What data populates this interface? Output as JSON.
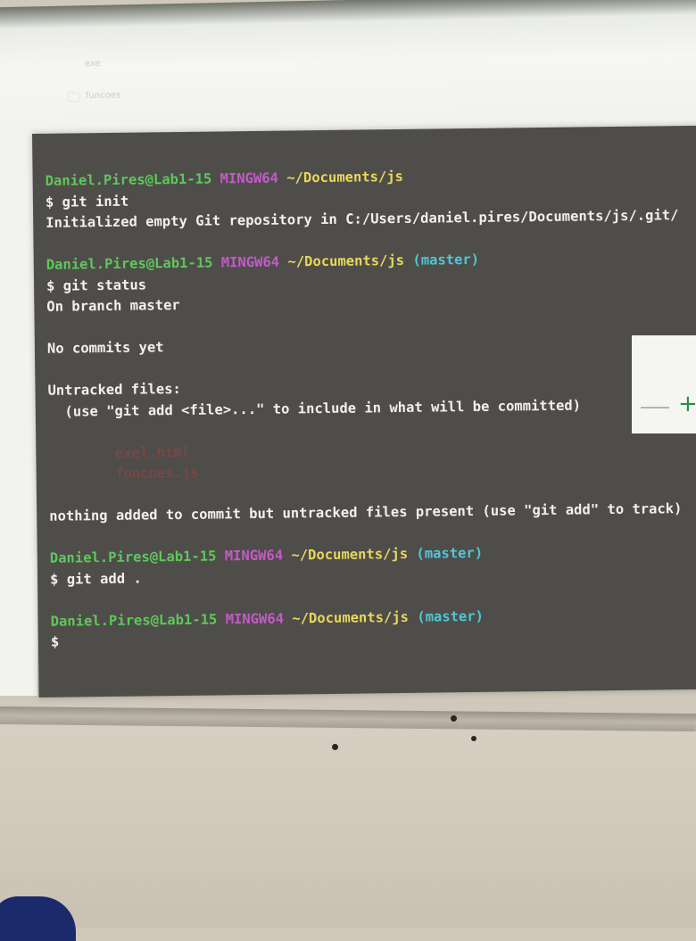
{
  "terminal": {
    "lines": [
      {
        "type": "prompt",
        "user": "Daniel.Pires@Lab1-15",
        "env": "MINGW64",
        "path": "~/Documents/js",
        "branch": ""
      },
      {
        "type": "cmd",
        "text": "$ git init"
      },
      {
        "type": "out",
        "text": "Initialized empty Git repository in C:/Users/daniel.pires/Documents/js/.git/"
      },
      {
        "type": "blank"
      },
      {
        "type": "prompt",
        "user": "Daniel.Pires@Lab1-15",
        "env": "MINGW64",
        "path": "~/Documents/js",
        "branch": "(master)"
      },
      {
        "type": "cmd",
        "text": "$ git status"
      },
      {
        "type": "out",
        "text": "On branch master"
      },
      {
        "type": "blank"
      },
      {
        "type": "out",
        "text": "No commits yet"
      },
      {
        "type": "blank"
      },
      {
        "type": "out",
        "text": "Untracked files:"
      },
      {
        "type": "out",
        "text": "  (use \"git add <file>...\" to include in what will be committed)"
      },
      {
        "type": "blank"
      },
      {
        "type": "untracked",
        "text": "        exel.html"
      },
      {
        "type": "untracked",
        "text": "        funcoes.js"
      },
      {
        "type": "blank"
      },
      {
        "type": "out",
        "text": "nothing added to commit but untracked files present (use \"git add\" to track)"
      },
      {
        "type": "blank"
      },
      {
        "type": "prompt",
        "user": "Daniel.Pires@Lab1-15",
        "env": "MINGW64",
        "path": "~/Documents/js",
        "branch": "(master)"
      },
      {
        "type": "cmd",
        "text": "$ git add ."
      },
      {
        "type": "blank"
      },
      {
        "type": "prompt",
        "user": "Daniel.Pires@Lab1-15",
        "env": "MINGW64",
        "path": "~/Documents/js",
        "branch": "(master)"
      },
      {
        "type": "cmd",
        "text": "$"
      }
    ]
  },
  "background_window": {
    "file_label": "exe",
    "folder_label": "funcoes"
  },
  "colors": {
    "terminal_bg": "#4f4d4a",
    "user": "#5ec85a",
    "env": "#c45ac8",
    "path": "#e8d75a",
    "branch": "#4fc7d8",
    "untracked": "#c2413c"
  }
}
